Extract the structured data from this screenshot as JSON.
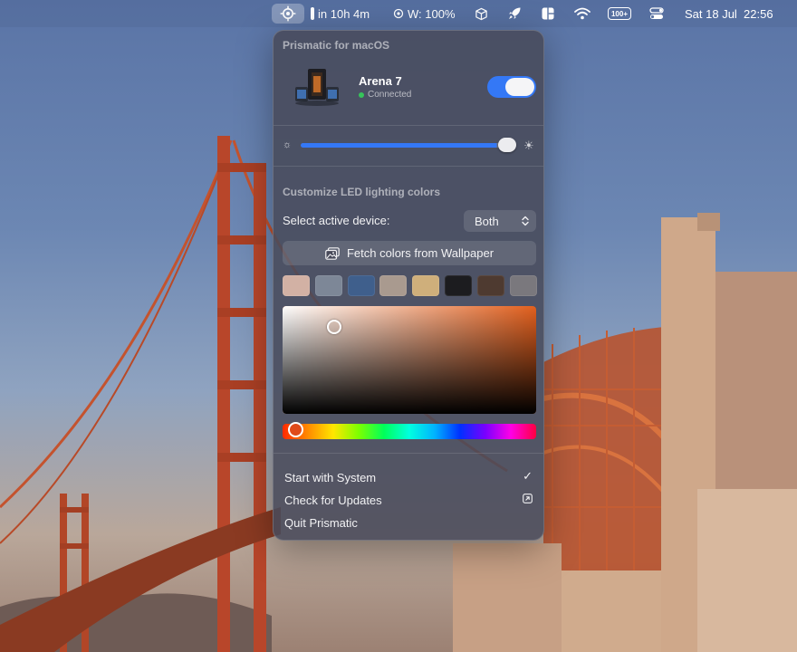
{
  "menubar": {
    "battery_time": "in 10h 4m",
    "cpu_label": "W: 100%",
    "battery_badge": "100+",
    "datetime": "Sat 18 Jul  22:56",
    "icons": [
      "prismatic-icon",
      "battery-icon",
      "cpu-icon",
      "cube-icon",
      "rocket-icon",
      "layout-icon",
      "wifi-icon",
      "battery-percent-icon",
      "control-center-icon"
    ]
  },
  "popover": {
    "title": "Prismatic for macOS",
    "device": {
      "name": "Arena 7",
      "status": "Connected",
      "enabled": true
    },
    "brightness": 0.95,
    "section_title": "Customize LED lighting colors",
    "select_label": "Select active device:",
    "select_value": "Both",
    "fetch_label": "Fetch colors from Wallpaper",
    "swatches": [
      "#d2b1a4",
      "#7d8797",
      "#3f5f8c",
      "#a99a8f",
      "#cfaf7b",
      "#1c1c1f",
      "#4e3a30",
      "#7a787d"
    ],
    "picker_hue": "#e2601e",
    "menu": {
      "start_with_system": "Start with System",
      "check_updates": "Check for Updates",
      "quit": "Quit Prismatic"
    }
  },
  "colors": {
    "accent": "#3478f6",
    "status_connected": "#36c45a"
  }
}
